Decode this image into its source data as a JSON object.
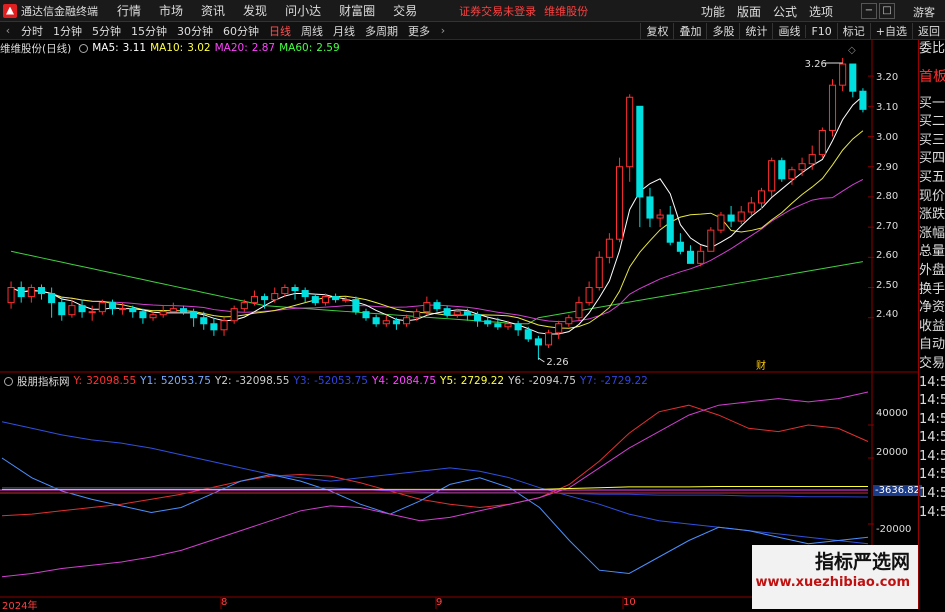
{
  "app": {
    "title": "通达信金融终端",
    "menus": [
      "行情",
      "市场",
      "资讯",
      "发现",
      "问小达",
      "财富圈",
      "交易"
    ],
    "alert": "证券交易未登录",
    "stock_name_top": "维维股份",
    "right_menus": [
      "功能",
      "版面",
      "公式",
      "选项"
    ],
    "guest": "游客"
  },
  "periods": {
    "items": [
      "分时",
      "1分钟",
      "5分钟",
      "15分钟",
      "30分钟",
      "60分钟",
      "日线",
      "周线",
      "月线",
      "多周期",
      "更多"
    ],
    "active": "日线"
  },
  "tools": [
    "复权",
    "叠加",
    "多股",
    "统计",
    "画线",
    "F10",
    "标记",
    "+自选",
    "返回"
  ],
  "main": {
    "title": "维维股份(日线)",
    "ma": [
      {
        "label": "MA5:",
        "val": "3.11",
        "color": "#ffffff"
      },
      {
        "label": "MA10:",
        "val": "3.02",
        "color": "#ffff40"
      },
      {
        "label": "MA20:",
        "val": "2.87",
        "color": "#ff40ff"
      },
      {
        "label": "MA60:",
        "val": "2.59",
        "color": "#40ff40"
      }
    ],
    "high_mark": "3.26",
    "low_mark": "2.26",
    "fin_mark": "财",
    "y_ticks": [
      "3.20",
      "3.10",
      "3.00",
      "2.90",
      "2.80",
      "2.70",
      "2.60",
      "2.50",
      "2.40"
    ]
  },
  "sub": {
    "title": "股朋指标网",
    "vals": [
      {
        "label": "Y:",
        "val": "32098.55",
        "color": "#ff3030"
      },
      {
        "label": "Y1:",
        "val": "52053.75",
        "color": "#5a8cff"
      },
      {
        "label": "Y2:",
        "val": "-32098.55",
        "color": "#cfcfcf"
      },
      {
        "label": "Y3:",
        "val": "-52053.75",
        "color": "#3040d0"
      },
      {
        "label": "Y4:",
        "val": "2084.75",
        "color": "#ff40ff"
      },
      {
        "label": "Y5:",
        "val": "2729.22",
        "color": "#ffff40"
      },
      {
        "label": "Y6:",
        "val": "-2094.75",
        "color": "#cfcfcf"
      },
      {
        "label": "Y7:",
        "val": "-2729.22",
        "color": "#3040d0"
      }
    ],
    "y_ticks": [
      "40000",
      "20000",
      "-20000"
    ],
    "cur_val": "-3636.82"
  },
  "x_labels": [
    "2024年",
    "8",
    "9",
    "10"
  ],
  "right_panel": {
    "items": [
      "委比",
      "首板",
      "买一",
      "买二",
      "买三",
      "买四",
      "买五",
      "现价",
      "涨跌",
      "涨幅",
      "总量",
      "外盘",
      "换手",
      "净资",
      "收益",
      "自动",
      "交易",
      "14:56",
      "14:56",
      "14:56",
      "14:56",
      "14:56",
      "14:56",
      "14:56",
      "14:56"
    ]
  },
  "watermark": {
    "line1": "指标严选网",
    "line2": "www.xuezhibiao.com"
  },
  "chart_data": [
    {
      "type": "candlestick",
      "title": "维维股份(日线)",
      "x_labels": [
        "2024年",
        "8",
        "9",
        "10"
      ],
      "ylim": [
        2.26,
        3.26
      ],
      "y_ticks": [
        2.4,
        2.5,
        2.6,
        2.7,
        2.8,
        2.9,
        3.0,
        3.1,
        3.2
      ],
      "candles": [
        [
          2.45,
          2.5,
          2.52,
          2.43
        ],
        [
          2.5,
          2.47,
          2.52,
          2.45
        ],
        [
          2.47,
          2.5,
          2.51,
          2.45
        ],
        [
          2.5,
          2.48,
          2.51,
          2.46
        ],
        [
          2.48,
          2.45,
          2.5,
          2.4
        ],
        [
          2.45,
          2.41,
          2.47,
          2.39
        ],
        [
          2.41,
          2.44,
          2.46,
          2.4
        ],
        [
          2.44,
          2.42,
          2.46,
          2.4
        ],
        [
          2.42,
          2.42,
          2.44,
          2.39
        ],
        [
          2.42,
          2.45,
          2.46,
          2.41
        ],
        [
          2.45,
          2.43,
          2.46,
          2.41
        ],
        [
          2.43,
          2.43,
          2.45,
          2.41
        ],
        [
          2.43,
          2.42,
          2.44,
          2.4
        ],
        [
          2.42,
          2.4,
          2.43,
          2.38
        ],
        [
          2.4,
          2.41,
          2.42,
          2.39
        ],
        [
          2.41,
          2.42,
          2.44,
          2.4
        ],
        [
          2.42,
          2.43,
          2.45,
          2.42
        ],
        [
          2.43,
          2.42,
          2.44,
          2.41
        ],
        [
          2.42,
          2.4,
          2.43,
          2.37
        ],
        [
          2.4,
          2.38,
          2.42,
          2.36
        ],
        [
          2.38,
          2.36,
          2.4,
          2.34
        ],
        [
          2.36,
          2.39,
          2.4,
          2.34
        ],
        [
          2.39,
          2.43,
          2.44,
          2.38
        ],
        [
          2.43,
          2.45,
          2.46,
          2.42
        ],
        [
          2.45,
          2.47,
          2.49,
          2.44
        ],
        [
          2.47,
          2.46,
          2.48,
          2.43
        ],
        [
          2.46,
          2.48,
          2.5,
          2.45
        ],
        [
          2.48,
          2.5,
          2.51,
          2.47
        ],
        [
          2.5,
          2.49,
          2.51,
          2.46
        ],
        [
          2.49,
          2.47,
          2.5,
          2.45
        ],
        [
          2.47,
          2.45,
          2.48,
          2.44
        ],
        [
          2.45,
          2.47,
          2.48,
          2.44
        ],
        [
          2.47,
          2.46,
          2.48,
          2.45
        ],
        [
          2.46,
          2.46,
          2.47,
          2.45
        ],
        [
          2.46,
          2.42,
          2.47,
          2.41
        ],
        [
          2.42,
          2.4,
          2.43,
          2.39
        ],
        [
          2.4,
          2.38,
          2.41,
          2.37
        ],
        [
          2.38,
          2.39,
          2.41,
          2.37
        ],
        [
          2.39,
          2.38,
          2.4,
          2.36
        ],
        [
          2.38,
          2.4,
          2.41,
          2.37
        ],
        [
          2.4,
          2.42,
          2.43,
          2.39
        ],
        [
          2.42,
          2.45,
          2.47,
          2.41
        ],
        [
          2.45,
          2.43,
          2.46,
          2.42
        ],
        [
          2.43,
          2.41,
          2.44,
          2.4
        ],
        [
          2.41,
          2.42,
          2.43,
          2.4
        ],
        [
          2.42,
          2.41,
          2.43,
          2.39
        ],
        [
          2.41,
          2.39,
          2.42,
          2.37
        ],
        [
          2.39,
          2.38,
          2.4,
          2.37
        ],
        [
          2.38,
          2.37,
          2.4,
          2.36
        ],
        [
          2.37,
          2.38,
          2.39,
          2.36
        ],
        [
          2.38,
          2.36,
          2.39,
          2.34
        ],
        [
          2.36,
          2.33,
          2.37,
          2.32
        ],
        [
          2.33,
          2.31,
          2.34,
          2.26
        ],
        [
          2.31,
          2.35,
          2.36,
          2.3
        ],
        [
          2.35,
          2.38,
          2.39,
          2.33
        ],
        [
          2.38,
          2.4,
          2.41,
          2.37
        ],
        [
          2.4,
          2.45,
          2.47,
          2.39
        ],
        [
          2.45,
          2.5,
          2.52,
          2.44
        ],
        [
          2.5,
          2.6,
          2.62,
          2.49
        ],
        [
          2.6,
          2.66,
          2.68,
          2.58
        ],
        [
          2.66,
          2.9,
          2.93,
          2.65
        ],
        [
          2.9,
          3.13,
          3.14,
          2.85
        ],
        [
          3.1,
          2.8,
          2.98,
          2.7
        ],
        [
          2.8,
          2.73,
          2.83,
          2.7
        ],
        [
          2.73,
          2.74,
          2.76,
          2.7
        ],
        [
          2.74,
          2.65,
          2.77,
          2.64
        ],
        [
          2.65,
          2.62,
          2.68,
          2.61
        ],
        [
          2.62,
          2.58,
          2.64,
          2.58
        ],
        [
          2.58,
          2.62,
          2.64,
          2.57
        ],
        [
          2.62,
          2.69,
          2.7,
          2.62
        ],
        [
          2.69,
          2.74,
          2.75,
          2.68
        ],
        [
          2.74,
          2.72,
          2.77,
          2.7
        ],
        [
          2.72,
          2.75,
          2.77,
          2.71
        ],
        [
          2.75,
          2.78,
          2.8,
          2.74
        ],
        [
          2.78,
          2.82,
          2.83,
          2.76
        ],
        [
          2.82,
          2.92,
          2.93,
          2.8
        ],
        [
          2.92,
          2.86,
          2.93,
          2.85
        ],
        [
          2.86,
          2.89,
          2.9,
          2.84
        ],
        [
          2.89,
          2.91,
          2.93,
          2.87
        ],
        [
          2.91,
          2.94,
          2.97,
          2.89
        ],
        [
          2.94,
          3.02,
          3.03,
          2.93
        ],
        [
          3.02,
          3.17,
          3.19,
          3.0
        ],
        [
          3.17,
          3.24,
          3.26,
          3.15
        ],
        [
          3.24,
          3.15,
          3.24,
          3.13
        ],
        [
          3.15,
          3.09,
          3.16,
          3.08
        ]
      ]
    },
    {
      "type": "line",
      "title": "股朋指标网",
      "ylim": [
        -60000,
        60000
      ],
      "y_ticks": [
        40000,
        20000,
        -20000
      ],
      "series": [
        {
          "name": "Y",
          "values": [
            -15000,
            -14000,
            -12000,
            -10000,
            -8000,
            -5000,
            -2000,
            2000,
            6000,
            9000,
            10000,
            9000,
            5000,
            0,
            -5000,
            -8000,
            -10000,
            -8000,
            -4000,
            4000,
            18000,
            35000,
            48000,
            52000,
            46000,
            38000,
            36000,
            40000,
            38000,
            30000
          ]
        },
        {
          "name": "Y1",
          "values": [
            42000,
            38000,
            34000,
            31000,
            29000,
            26000,
            22000,
            18000,
            14000,
            10000,
            8000,
            6000,
            8000,
            10000,
            12000,
            14000,
            12000,
            8000,
            2000,
            -3000,
            -8000,
            -14000,
            -18000,
            -20000,
            -22000,
            -24000,
            -26000,
            -28000,
            -30000,
            -32000
          ]
        },
        {
          "name": "Y2",
          "values": [
            20000,
            8000,
            0,
            -5000,
            -9000,
            -13000,
            -10000,
            -2000,
            6000,
            10000,
            6000,
            0,
            -8000,
            -14000,
            -6000,
            4000,
            8000,
            2000,
            -10000,
            -30000,
            -48000,
            -50000,
            -40000,
            -30000,
            -22000,
            -24000,
            -28000,
            -32000,
            -30000,
            -28000
          ]
        },
        {
          "name": "Y3",
          "values": [
            2000,
            2000,
            2000,
            2000,
            2000,
            2000,
            2000,
            2000,
            2000,
            2000,
            2000,
            2000,
            1000,
            0,
            -500,
            -1000,
            -1000,
            -1000,
            -1000,
            -1500,
            -2000,
            -2000,
            -2500,
            -2500,
            -2500,
            -3000,
            -3000,
            -3500,
            -3500,
            -3600
          ]
        },
        {
          "name": "Y4",
          "values": [
            -52000,
            -50000,
            -47000,
            -45000,
            -43000,
            -40000,
            -36000,
            -30000,
            -24000,
            -18000,
            -12000,
            -9000,
            -10000,
            -14000,
            -18000,
            -16000,
            -12000,
            -8000,
            -4000,
            2000,
            14000,
            26000,
            36000,
            46000,
            52000,
            54000,
            56000,
            54000,
            56000,
            60000
          ]
        },
        {
          "name": "Y5",
          "values": [
            1000,
            1000,
            1000,
            1000,
            1000,
            1000,
            1000,
            1000,
            1000,
            1000,
            1000,
            1000,
            1000,
            1000,
            1000,
            1000,
            1000,
            1000,
            1000,
            1500,
            2000,
            2500,
            2500,
            2500,
            2700,
            2700,
            2700,
            2700,
            2700,
            2729
          ]
        }
      ]
    }
  ]
}
